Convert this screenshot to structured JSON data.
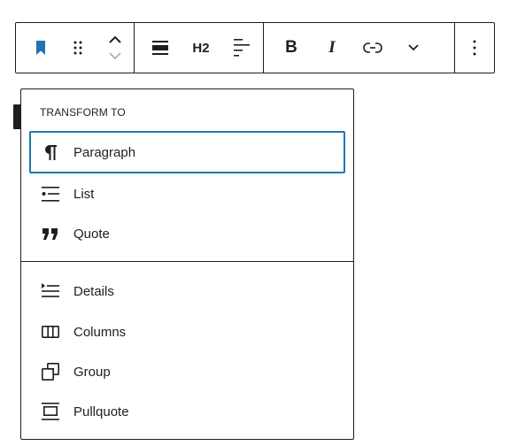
{
  "toolbar": {
    "heading_level_label": "H2",
    "bold_label": "B",
    "italic_label": "I"
  },
  "menu": {
    "title": "TRANSFORM TO",
    "items": [
      {
        "label": "Paragraph",
        "icon": "paragraph-icon"
      },
      {
        "label": "List",
        "icon": "list-icon"
      },
      {
        "label": "Quote",
        "icon": "quote-icon"
      },
      {
        "label": "Details",
        "icon": "details-icon"
      },
      {
        "label": "Columns",
        "icon": "columns-icon"
      },
      {
        "label": "Group",
        "icon": "group-icon"
      },
      {
        "label": "Pullquote",
        "icon": "pullquote-icon"
      }
    ]
  },
  "colors": {
    "accent": "#1e78b4",
    "bookmark": "#2271b1",
    "text": "#1e1e1e"
  }
}
